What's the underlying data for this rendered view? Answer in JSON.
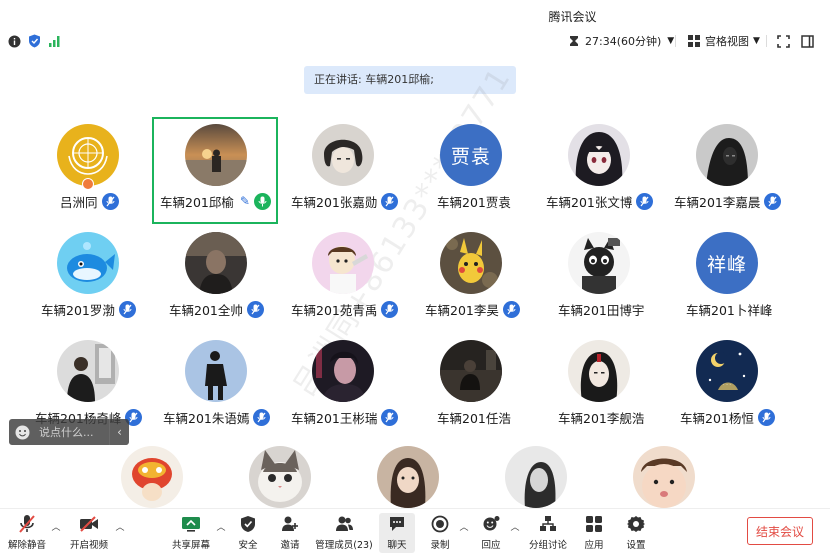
{
  "window": {
    "title": "腾讯会议"
  },
  "info_bar": {
    "timer": "27:34(60分钟)",
    "view_mode": "宫格视图"
  },
  "speaking_banner": "正在讲话: 车辆201邱榆;",
  "participants": [
    {
      "name": "吕洲同",
      "avatar": "un-logo",
      "host": true
    },
    {
      "name": "车辆201邱榆",
      "avatar": "sunset-photo",
      "active": true
    },
    {
      "name": "车辆201张嘉勋",
      "avatar": "anime-boy"
    },
    {
      "name": "车辆201贾袁",
      "avatar_text": "贾袁"
    },
    {
      "name": "车辆201张文博",
      "avatar": "anime-girl"
    },
    {
      "name": "车辆201李嘉晨",
      "avatar": "hooded-figure"
    },
    {
      "name": "车辆201罗渤",
      "avatar": "cartoon-whale"
    },
    {
      "name": "车辆201全帅",
      "avatar": "dark-portrait"
    },
    {
      "name": "车辆201苑青禹",
      "avatar": "cartoon-boy"
    },
    {
      "name": "车辆201李昊",
      "avatar": "pikachu-toy"
    },
    {
      "name": "车辆201田博宇",
      "avatar": "cartoon-cat"
    },
    {
      "name": "车辆201卜祥峰",
      "avatar_text": "祥峰"
    },
    {
      "name": "车辆201杨奇峰",
      "avatar": "person-photo"
    },
    {
      "name": "车辆201朱语嫣",
      "avatar": "silhouette"
    },
    {
      "name": "车辆201王彬瑞",
      "avatar": "neon-portrait"
    },
    {
      "name": "车辆201任浩",
      "avatar": "dark-room"
    },
    {
      "name": "车辆201李舰浩",
      "avatar": "ink-character"
    },
    {
      "name": "车辆201杨恒",
      "avatar": "night-sky"
    },
    {
      "name": "",
      "avatar": "lion-dance"
    },
    {
      "name": "",
      "avatar": "cat-face"
    },
    {
      "name": "",
      "avatar": "girl-photo"
    },
    {
      "name": "",
      "avatar": "bw-portrait"
    },
    {
      "name": "",
      "avatar": "baby-face"
    }
  ],
  "chat": {
    "placeholder": "说点什么..."
  },
  "watermark": "吕洲同+86133****2771",
  "toolbar": {
    "unmute": "解除静音",
    "video": "开启视频",
    "share": "共享屏幕",
    "security": "安全",
    "invite": "邀请",
    "members": "管理成员(23)",
    "chat": "聊天",
    "record": "录制",
    "reaction": "回应",
    "breakout": "分组讨论",
    "apps": "应用",
    "settings": "设置",
    "end": "结束会议"
  },
  "colors": {
    "accent_blue": "#2f6fd8",
    "active_border": "#1bb45c",
    "end_red": "#e24b43",
    "text_avatar_bg": "#3c6fc4"
  }
}
